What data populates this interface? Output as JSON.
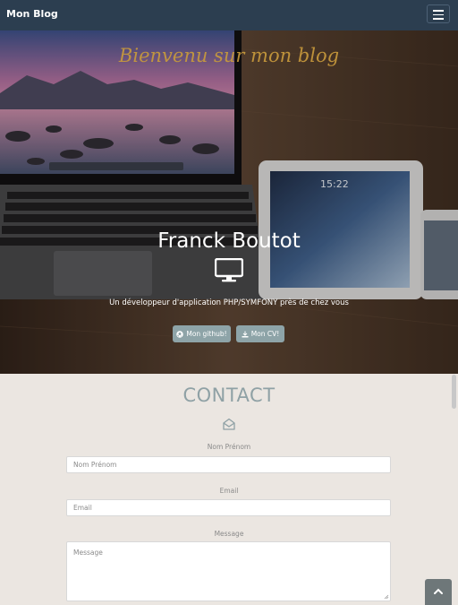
{
  "navbar": {
    "brand": "Mon Blog",
    "menu_icon": "hamburger-icon"
  },
  "hero": {
    "welcome": "Bienvenu sur mon blog",
    "name": "Franck Boutot",
    "icon": "desktop-icon",
    "tagline": "Un développeur d'application PHP/SYMFONY près de chez vous",
    "buttons": {
      "github": {
        "label": "Mon github!",
        "icon": "github-icon"
      },
      "cv": {
        "label": "Mon CV!",
        "icon": "download-icon"
      }
    }
  },
  "contact": {
    "title": "CONTACT",
    "icon": "envelope-open-icon",
    "name_field": {
      "label": "Nom Prénom",
      "placeholder": "Nom Prénom"
    },
    "email_field": {
      "label": "Email",
      "placeholder": "Email"
    },
    "message_field": {
      "label": "Message",
      "placeholder": "Message"
    }
  },
  "scroll_top": {
    "icon": "chevron-up-icon"
  },
  "colors": {
    "navbar": "#2c3e50",
    "accent_button": "#8ea4a8",
    "contact_title": "#8fa1a5",
    "page_background": "#ebe6e1",
    "welcome_text": "#c89a3c"
  }
}
